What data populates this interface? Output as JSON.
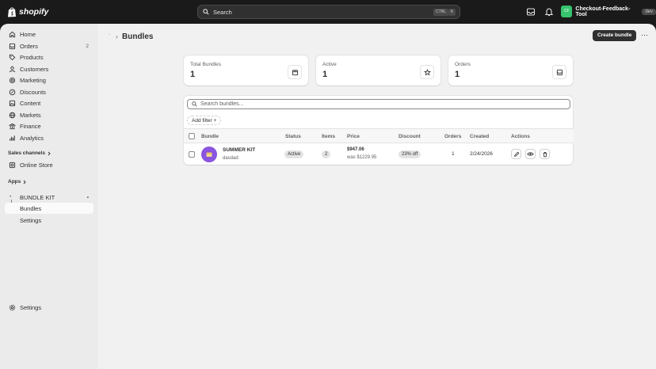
{
  "topbar": {
    "brand": "shopify",
    "search_label": "Search",
    "shortcut_ctrl": "CTRL",
    "shortcut_key": "K",
    "store_avatar_text": "CF",
    "store_name": "Checkout-Feedback-Tool",
    "env_badge": "dev"
  },
  "sidebar": {
    "items": [
      {
        "label": "Home",
        "icon": "home-icon"
      },
      {
        "label": "Orders",
        "icon": "orders-icon",
        "count": "2"
      },
      {
        "label": "Products",
        "icon": "tag-icon"
      },
      {
        "label": "Customers",
        "icon": "person-icon"
      },
      {
        "label": "Marketing",
        "icon": "target-icon"
      },
      {
        "label": "Discounts",
        "icon": "discount-icon"
      },
      {
        "label": "Content",
        "icon": "content-icon"
      },
      {
        "label": "Markets",
        "icon": "globe-icon"
      },
      {
        "label": "Finance",
        "icon": "bank-icon"
      },
      {
        "label": "Analytics",
        "icon": "chart-icon"
      }
    ],
    "sales_channels_label": "Sales channels",
    "online_store_label": "Online Store",
    "apps_label": "Apps",
    "app_name": "BUNDLE KIT",
    "app_subitems": [
      "Bundles",
      "Settings"
    ],
    "settings_label": "Settings"
  },
  "page": {
    "title": "Bundles",
    "create_button": "Create bundle"
  },
  "stats": [
    {
      "label": "Total Bundles",
      "value": "1",
      "icon": "package-icon"
    },
    {
      "label": "Active",
      "value": "1",
      "icon": "star-icon"
    },
    {
      "label": "Orders",
      "value": "1",
      "icon": "inbox-icon"
    }
  ],
  "table": {
    "search_placeholder": "Search bundles...",
    "add_filter": "Add filter +",
    "headers": [
      "Bundle",
      "Status",
      "Items",
      "Price",
      "Discount",
      "Orders",
      "Created",
      "Actions"
    ],
    "rows": [
      {
        "name": "SUMMER KIT",
        "description": "dasdad",
        "status": "Active",
        "items": "2",
        "price": "$947.06",
        "was_price": "was $1229.95",
        "discount": "23% off",
        "orders": "1",
        "created": "2/24/2026"
      }
    ]
  }
}
